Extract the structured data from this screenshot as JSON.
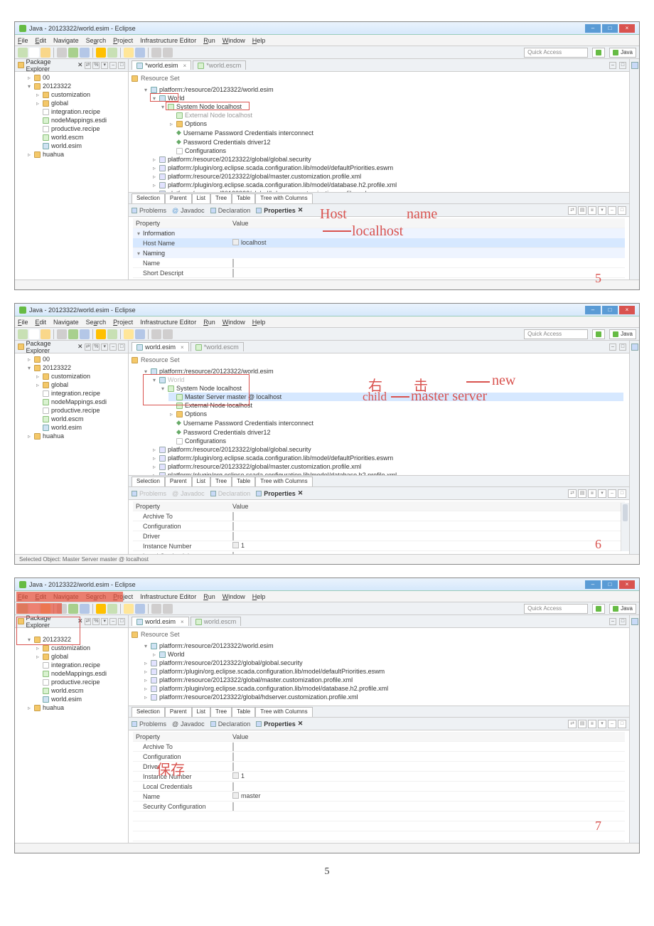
{
  "page_number": "5",
  "windowTitle": "Java - 20123322/world.esim - Eclipse",
  "menus": [
    "File",
    "Edit",
    "Navigate",
    "Search",
    "Project",
    "Infrastructure Editor",
    "Run",
    "Window",
    "Help"
  ],
  "quickAccess": "Quick Access",
  "perspective": "Java",
  "packageExplorer": {
    "title": "Package Explorer",
    "items": {
      "p00": "00",
      "proj": "20123322",
      "cust": "customization",
      "glob": "global",
      "intg": "integration.recipe",
      "nmap": "nodeMappings.esdi",
      "prod": "productive.recipe",
      "wescm": "world.escm",
      "wesim": "world.esim",
      "hua": "huahua"
    }
  },
  "editorTabs": {
    "a": "*world.esim",
    "b": "*world.escm",
    "c": "world.esim",
    "d": "world.escm"
  },
  "resourceSet": "Resource Set",
  "modeTabs": [
    "Selection",
    "Parent",
    "List",
    "Tree",
    "Table",
    "Tree with Columns"
  ],
  "panelTabs": [
    "Problems",
    "Javadoc",
    "Declaration",
    "Properties"
  ],
  "propHeader": {
    "k": "Property",
    "v": "Value"
  },
  "rs1": {
    "root": "platform:/resource/20123322/world.esim",
    "world": "World",
    "sysnode": "System Node localhost",
    "extnode": "External Node localhost",
    "opts": "Options",
    "cred1": "Username Password Credentials interconnect",
    "cred2": "Password Credentials driver12",
    "conf": "Configurations",
    "l1": "platform:/resource/20123322/global/global.security",
    "l2": "platform:/plugin/org.eclipse.scada.configuration.lib/model/defaultPriorities.eswm",
    "l3": "platform:/resource/20123322/global/master.customization.profile.xml",
    "l4": "platform:/plugin/org.eclipse.scada.configuration.lib/model/database.h2.profile.xml",
    "l5": "platform:/resource/20123322/global/hdserver.customization.profile.xml"
  },
  "rs2": {
    "master": "Master Server master @ localhost"
  },
  "rs3": {
    "world": "World"
  },
  "props1": {
    "catInfo": "Information",
    "hostName": "Host Name",
    "hostVal": "localhost",
    "catNaming": "Naming",
    "name": "Name",
    "short": "Short Descript"
  },
  "props2": {
    "arch": "Archive To",
    "conf": "Configuration",
    "drv": "Driver",
    "inst": "Instance Number",
    "instV": "1",
    "loc": "Local Credentials",
    "name": "Name",
    "nameV": "master"
  },
  "props3": {
    "arch": "Archive To",
    "conf": "Configuration",
    "drv": "Driver",
    "inst": "Instance Number",
    "instV": "1",
    "loc": "Local Credentials",
    "name": "Name",
    "nameV": "master",
    "sec": "Security Configuration"
  },
  "status2": "Selected Object: Master Server master @ localhost",
  "annotations": {
    "s1": {
      "a": "Host",
      "b": "name",
      "c": "localhost",
      "num": "5"
    },
    "s2": {
      "a": "右",
      "b": "击",
      "c": "new",
      "d": "child",
      "e": "master server",
      "num": "6"
    },
    "s3": {
      "a": "保存",
      "num": "7"
    }
  }
}
